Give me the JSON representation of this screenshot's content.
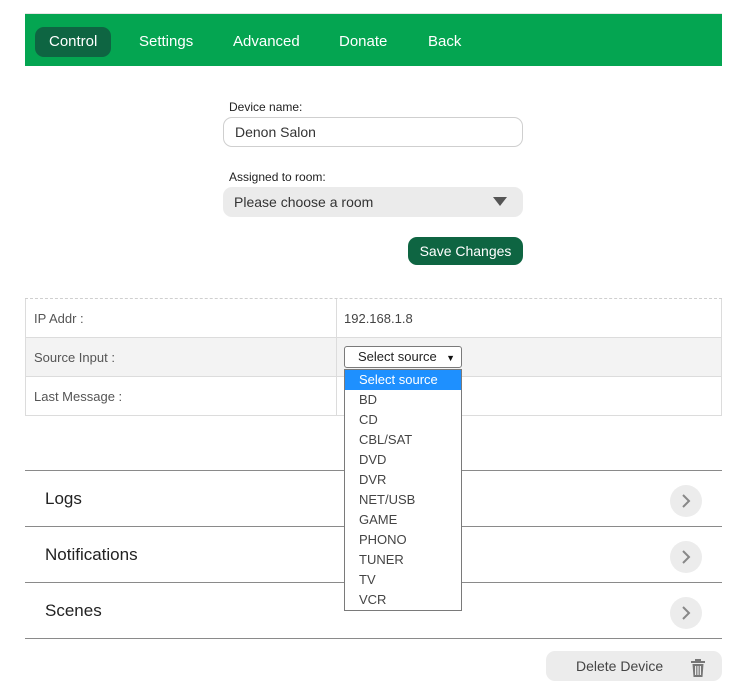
{
  "nav": {
    "items": [
      {
        "label": "Control",
        "active": true
      },
      {
        "label": "Settings",
        "active": false
      },
      {
        "label": "Advanced",
        "active": false
      },
      {
        "label": "Donate",
        "active": false
      },
      {
        "label": "Back",
        "active": false
      }
    ]
  },
  "form": {
    "device_name_label": "Device name:",
    "device_name_value": "Denon Salon",
    "room_label": "Assigned to room:",
    "room_value": "Please choose a room",
    "save_label": "Save Changes"
  },
  "info": {
    "rows": [
      {
        "key": "IP Addr :",
        "value": "192.168.1.8"
      },
      {
        "key": "Source Input :",
        "value": "Select source"
      },
      {
        "key": "Last Message :",
        "value": ""
      }
    ]
  },
  "source_dropdown": {
    "selected": "Select source",
    "options": [
      "Select source",
      "BD",
      "CD",
      "CBL/SAT",
      "DVD",
      "DVR",
      "NET/USB",
      "GAME",
      "PHONO",
      "TUNER",
      "TV",
      "VCR"
    ]
  },
  "sections": [
    {
      "title": "Logs"
    },
    {
      "title": "Notifications"
    },
    {
      "title": "Scenes"
    }
  ],
  "delete_label": "Delete Device",
  "colors": {
    "nav_bg": "#04a551",
    "active_bg": "#0e6542",
    "dropdown_highlight": "#1e90ff"
  },
  "icons": {
    "room_select": "chevron-down-icon",
    "source_select": "triangle-down-icon",
    "section": "chevron-right-icon",
    "delete": "trash-icon"
  }
}
